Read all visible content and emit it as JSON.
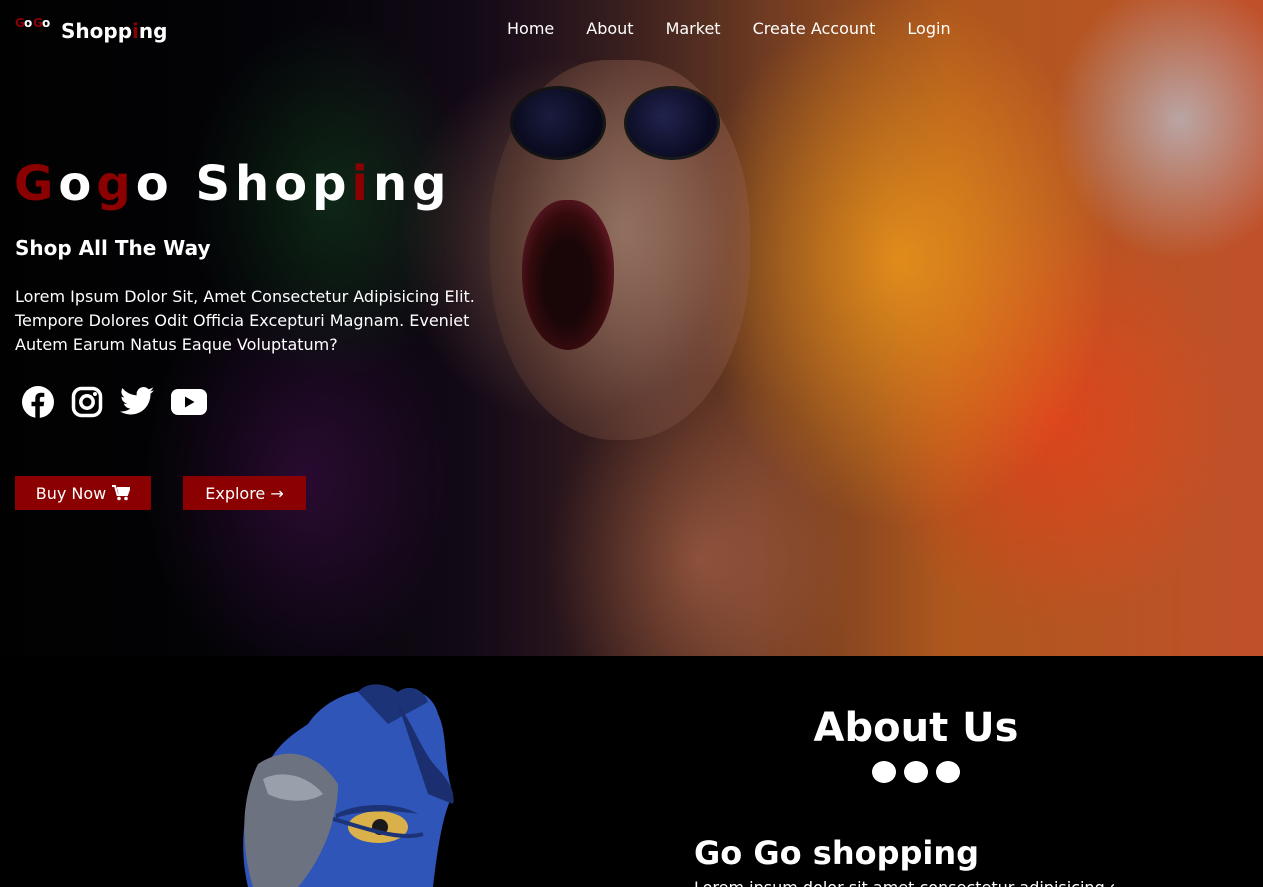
{
  "logo": {
    "small_parts": [
      "G",
      "o",
      "G",
      "o"
    ],
    "big_parts": [
      "Shopp",
      "i",
      "ng"
    ]
  },
  "nav": {
    "items": [
      "Home",
      "About",
      "Market",
      "Create Account",
      "Login"
    ]
  },
  "hero": {
    "title_parts": [
      "G",
      "o",
      "g",
      "o Shop",
      "i",
      "ng"
    ],
    "subtitle": "Shop All The Way",
    "text": "Lorem Ipsum Dolor Sit, Amet Consectetur Adipisicing Elit. Tempore Dolores Odit Officia Excepturi Magnam. Eveniet Autem Earum Natus Eaque Voluptatum?",
    "social_icons": [
      "facebook-icon",
      "instagram-icon",
      "twitter-icon",
      "youtube-icon"
    ],
    "buy_label": "Buy Now",
    "explore_label": "Explore →"
  },
  "about": {
    "title": "About Us",
    "subtitle": "Go Go shopping",
    "text": "Lorem ipsum dolor sit amet consectetur adipisicing elit"
  },
  "colors": {
    "accent": "#8b0000",
    "background": "#000000",
    "text": "#ffffff"
  }
}
